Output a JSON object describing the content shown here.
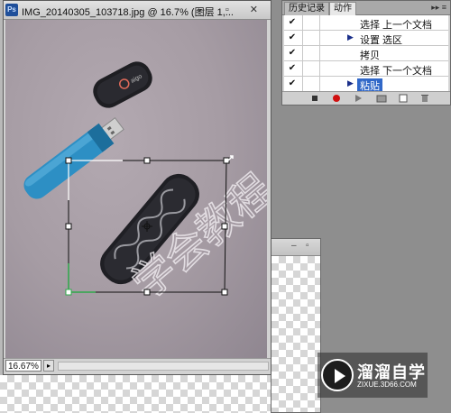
{
  "document": {
    "title": "IMG_20140305_103718.jpg @ 16.7% (图层 1,...",
    "app_icon": "Ps",
    "window_buttons": [
      "–",
      "▫",
      "✕"
    ],
    "zoom": "16.67%",
    "watermark_text": "学会教程"
  },
  "document_back": {
    "window_buttons": [
      "–",
      "▫"
    ]
  },
  "panel": {
    "tabs": [
      "历史记录",
      "动作"
    ],
    "menu_icon": "▸▸ ≡",
    "rows": [
      {
        "check": "✔",
        "arrow": "",
        "label": "选择 上一个文档"
      },
      {
        "check": "✔",
        "arrow": "▶",
        "label": "设置 选区"
      },
      {
        "check": "✔",
        "arrow": "",
        "label": "拷贝"
      },
      {
        "check": "✔",
        "arrow": "",
        "label": "选择 下一个文档"
      },
      {
        "check": "✔",
        "arrow": "▶",
        "label": "粘贴"
      }
    ],
    "footer_icons": [
      "stop-icon",
      "record-icon",
      "play-icon",
      "new-set-icon",
      "new-action-icon",
      "delete-icon"
    ]
  },
  "watermark": {
    "name": "溜溜自学",
    "url": "ZIXUE.3D66.COM"
  },
  "colors": {
    "selection_highlight": "#3168c8",
    "record": "#d01010",
    "usb_blue": "#2d8fc4",
    "handle_green": "#2ea84a"
  }
}
